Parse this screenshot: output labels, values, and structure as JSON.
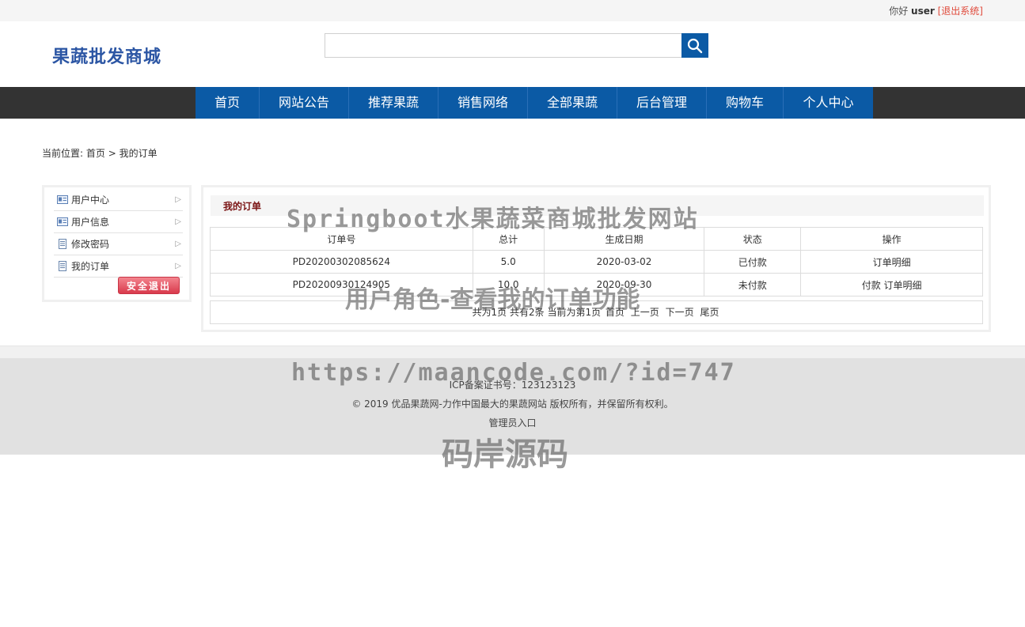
{
  "topbar": {
    "greeting": "你好",
    "username": "user",
    "logout": "[退出系统]"
  },
  "header": {
    "logo": "果蔬批发商城",
    "search_placeholder": "",
    "search_icon": "search-icon"
  },
  "nav": [
    "首页",
    "网站公告",
    "推荐果蔬",
    "销售网络",
    "全部果蔬",
    "后台管理",
    "购物车",
    "个人中心"
  ],
  "breadcrumb": {
    "prefix": "当前位置:",
    "home": "首页",
    "sep": ">",
    "current": "我的订单"
  },
  "sidebar": {
    "items": [
      {
        "label": "用户中心",
        "icon": "id-card-icon"
      },
      {
        "label": "用户信息",
        "icon": "id-card-icon"
      },
      {
        "label": "修改密码",
        "icon": "document-icon"
      },
      {
        "label": "我的订单",
        "icon": "document-icon"
      }
    ],
    "arrow": "▷",
    "exit_button": "安全退出"
  },
  "orders": {
    "title": "我的订单",
    "columns": [
      "订单号",
      "总计",
      "生成日期",
      "状态",
      "操作"
    ],
    "rows": [
      {
        "id": "PD20200302085624",
        "total": "5.0",
        "date": "2020-03-02",
        "status": "已付款",
        "ops": [
          "订单明细"
        ]
      },
      {
        "id": "PD20200930124905",
        "total": "10.0",
        "date": "2020-09-30",
        "status": "未付款",
        "ops": [
          "付款",
          "订单明细"
        ]
      }
    ],
    "pager": {
      "total_pages": "共为1页",
      "total_items": "共有2条",
      "current": "当前为第1页",
      "first": "首页",
      "prev": "上一页",
      "next": "下一页",
      "last": "尾页"
    }
  },
  "footer": {
    "icp": "ICP备案证书号：123123123",
    "copyright": "© 2019 优品果蔬网-力作中国最大的果蔬网站 版权所有，并保留所有权利。",
    "admin_link": "管理员入口"
  },
  "watermarks": [
    "Springboot水果蔬菜商城批发网站",
    "用户角色-查看我的订单功能",
    "https://maancode.com/?id=747",
    "码岸源码"
  ]
}
